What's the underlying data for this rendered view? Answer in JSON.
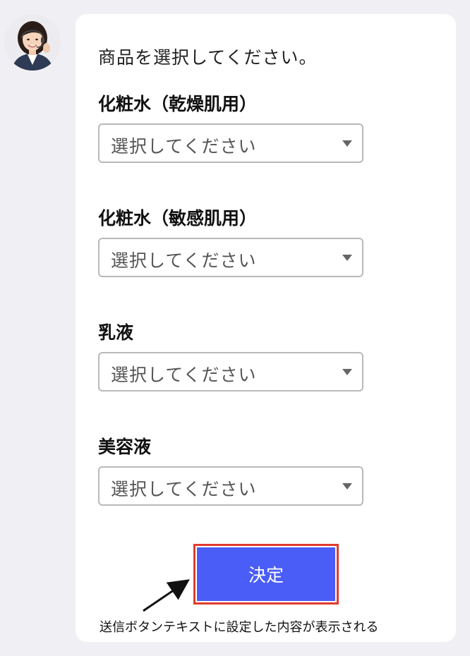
{
  "prompt_text": "商品を選択してください。",
  "groups": [
    {
      "label": "化粧水（乾燥肌用）",
      "select_value": "選択してください"
    },
    {
      "label": "化粧水（敏感肌用）",
      "select_value": "選択してください"
    },
    {
      "label": "乳液",
      "select_value": "選択してください"
    },
    {
      "label": "美容液",
      "select_value": "選択してください"
    }
  ],
  "submit": {
    "label": "決定"
  },
  "annotation": "送信ボタンテキストに設定した内容が表示される",
  "colors": {
    "button_bg": "#4a5df6",
    "highlight_border": "#e23b2e",
    "card_bg": "#ffffff",
    "page_bg": "#f0f0f4"
  },
  "icons": {
    "avatar": "operator-avatar",
    "dropdown": "caret-down-icon",
    "annotation_arrow": "arrow-icon"
  }
}
